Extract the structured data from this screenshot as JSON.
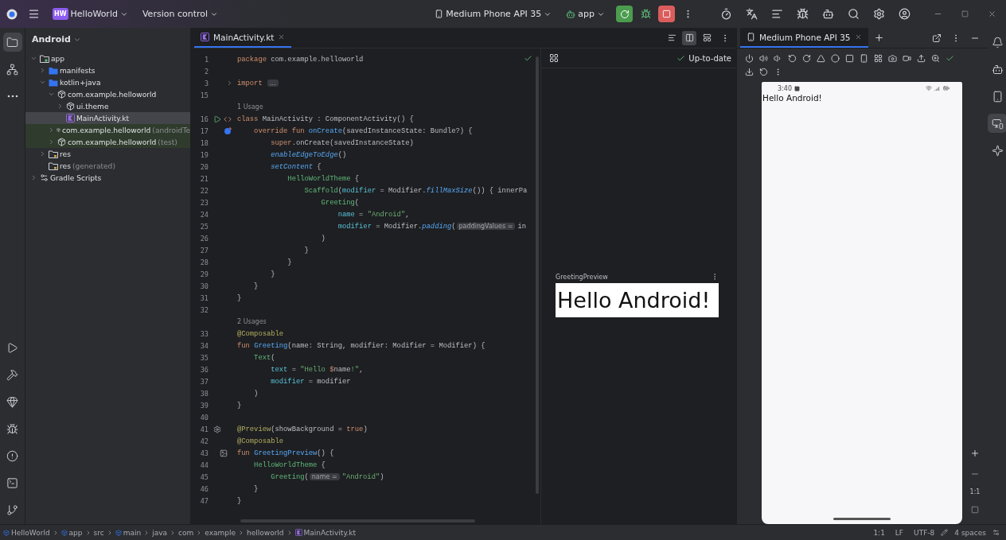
{
  "title_bar": {
    "project_badge": "HW",
    "project": "HelloWorld",
    "vcs": "Version control",
    "device": "Medium Phone API 35",
    "run_config": "app"
  },
  "left_tools": {
    "top": [
      {
        "kind": "project",
        "selected": true
      },
      {
        "kind": "structure",
        "selected": false
      },
      {
        "kind": "more",
        "selected": false
      }
    ],
    "bottom": [
      {
        "kind": "run",
        "selected": false
      },
      {
        "kind": "build",
        "selected": false
      },
      {
        "kind": "gem",
        "selected": false
      },
      {
        "kind": "logcat",
        "selected": false
      },
      {
        "kind": "problems",
        "selected": false
      },
      {
        "kind": "terminal",
        "selected": false
      },
      {
        "kind": "git",
        "selected": false
      }
    ]
  },
  "project_panel": {
    "title": "Android",
    "tree": [
      {
        "label": "app",
        "kind": "module",
        "expanded": true,
        "selected": false,
        "children": [
          {
            "label": "manifests",
            "kind": "source",
            "expanded": false,
            "selected": false
          },
          {
            "label": "kotlin+java",
            "kind": "source",
            "expanded": true,
            "selected": false,
            "children": [
              {
                "label": "com.example.helloworld",
                "kind": "package",
                "expanded": true,
                "selected": false,
                "children": [
                  {
                    "label": "ui.theme",
                    "kind": "package",
                    "expanded": false,
                    "selected": false
                  },
                  {
                    "label": "MainActivity.kt",
                    "kind": "kotlin",
                    "selected": true
                  }
                ]
              },
              {
                "label": "com.example.helloworld",
                "suffix": "(androidTe",
                "kind": "test-package",
                "expanded": false,
                "selected": false
              },
              {
                "label": "com.example.helloworld",
                "suffix": "(test)",
                "kind": "test-package",
                "expanded": false,
                "selected": false
              }
            ]
          },
          {
            "label": "res",
            "kind": "resource",
            "expanded": false,
            "selected": false
          },
          {
            "label": "res",
            "suffix": "(generated)",
            "kind": "resource",
            "selected": false
          }
        ]
      },
      {
        "label": "Gradle Scripts",
        "kind": "scripts",
        "expanded": false,
        "selected": false
      }
    ]
  },
  "editor": {
    "tab": {
      "label": "MainActivity.kt",
      "selected": true
    },
    "view_modes": [
      {
        "kind": "code",
        "selected": false
      },
      {
        "kind": "split",
        "selected": true
      },
      {
        "kind": "design",
        "selected": false
      }
    ],
    "lines": [
      {
        "kind": "code",
        "number": "1",
        "tokens": [
          {
            "text": "package ",
            "kind": "kw"
          },
          {
            "text": "com.example.helloworld",
            "kind": "plain"
          }
        ]
      },
      {
        "kind": "code",
        "number": "2"
      },
      {
        "kind": "code",
        "number": "3",
        "markers": [
          {
            "kind": "fold"
          }
        ],
        "tokens": [
          {
            "text": "import ",
            "kind": "kw"
          },
          {
            "text": "...",
            "kind": "fold"
          }
        ]
      },
      {
        "kind": "code",
        "number": "15"
      },
      {
        "kind": "usage",
        "text": "1 Usage"
      },
      {
        "kind": "code",
        "number": "16",
        "markers": [
          {
            "kind": "run"
          },
          {
            "kind": "code"
          }
        ],
        "tokens": [
          {
            "text": "class ",
            "kind": "kw"
          },
          {
            "text": "MainActivity : ComponentActivity() {",
            "kind": "plain"
          }
        ]
      },
      {
        "kind": "code",
        "number": "17",
        "markers": [
          {
            "kind": "override"
          }
        ],
        "tokens": [
          {
            "text": "    override fun ",
            "kind": "kw"
          },
          {
            "text": "onCreate",
            "kind": "fn"
          },
          {
            "text": "(savedInstanceState: Bundle?) {",
            "kind": "plain"
          }
        ]
      },
      {
        "kind": "code",
        "number": "18",
        "tokens": [
          {
            "text": "        super",
            "kind": "kw"
          },
          {
            "text": ".onCreate(savedInstanceState)",
            "kind": "plain"
          }
        ]
      },
      {
        "kind": "code",
        "number": "19",
        "tokens": [
          {
            "text": "        enableEdgeToEdge",
            "kind": "call"
          },
          {
            "text": "()",
            "kind": "plain"
          }
        ]
      },
      {
        "kind": "code",
        "number": "20",
        "tokens": [
          {
            "text": "        setContent",
            "kind": "call"
          },
          {
            "text": " {",
            "kind": "plain"
          }
        ]
      },
      {
        "kind": "code",
        "number": "21",
        "tokens": [
          {
            "text": "            HelloWorldTheme",
            "kind": "composable"
          },
          {
            "text": " {",
            "kind": "plain"
          }
        ]
      },
      {
        "kind": "code",
        "number": "22",
        "tokens": [
          {
            "text": "                Scaffold",
            "kind": "composable"
          },
          {
            "text": "(",
            "kind": "plain"
          },
          {
            "text": "modifier",
            "kind": "param"
          },
          {
            "text": " = Modifier.",
            "kind": "plain"
          },
          {
            "text": "fillMaxSize",
            "kind": "call"
          },
          {
            "text": "()) { innerPa",
            "kind": "plain"
          }
        ]
      },
      {
        "kind": "code",
        "number": "23",
        "tokens": [
          {
            "text": "                    Greeting",
            "kind": "composable"
          },
          {
            "text": "(",
            "kind": "plain"
          }
        ]
      },
      {
        "kind": "code",
        "number": "24",
        "tokens": [
          {
            "text": "                        name",
            "kind": "param"
          },
          {
            "text": " = ",
            "kind": "plain"
          },
          {
            "text": "\"Android\"",
            "kind": "string"
          },
          {
            "text": ",",
            "kind": "plain"
          }
        ]
      },
      {
        "kind": "code",
        "number": "25",
        "tokens": [
          {
            "text": "                        modifier",
            "kind": "param"
          },
          {
            "text": " = Modifier.",
            "kind": "plain"
          },
          {
            "text": "padding",
            "kind": "call"
          },
          {
            "text": "(",
            "kind": "plain"
          },
          {
            "text": "paddingValues =",
            "kind": "hint"
          },
          {
            "text": "in",
            "kind": "plain"
          }
        ]
      },
      {
        "kind": "code",
        "number": "26",
        "tokens": [
          {
            "text": "                    )",
            "kind": "plain"
          }
        ]
      },
      {
        "kind": "code",
        "number": "27",
        "tokens": [
          {
            "text": "                }",
            "kind": "plain"
          }
        ]
      },
      {
        "kind": "code",
        "number": "28",
        "tokens": [
          {
            "text": "            }",
            "kind": "plain"
          }
        ]
      },
      {
        "kind": "code",
        "number": "29",
        "tokens": [
          {
            "text": "        }",
            "kind": "plain"
          }
        ]
      },
      {
        "kind": "code",
        "number": "30",
        "tokens": [
          {
            "text": "    }",
            "kind": "plain"
          }
        ]
      },
      {
        "kind": "code",
        "number": "31",
        "tokens": [
          {
            "text": "}",
            "kind": "plain"
          }
        ]
      },
      {
        "kind": "code",
        "number": "32"
      },
      {
        "kind": "usage",
        "text": "2 Usages"
      },
      {
        "kind": "code",
        "number": "33",
        "tokens": [
          {
            "text": "@Composable",
            "kind": "annotation"
          }
        ]
      },
      {
        "kind": "code",
        "number": "34",
        "tokens": [
          {
            "text": "fun ",
            "kind": "kw"
          },
          {
            "text": "Greeting",
            "kind": "fn"
          },
          {
            "text": "(name: String, modifier: Modifier = Modifier) {",
            "kind": "plain"
          }
        ]
      },
      {
        "kind": "code",
        "number": "35",
        "tokens": [
          {
            "text": "    Text",
            "kind": "composable"
          },
          {
            "text": "(",
            "kind": "plain"
          }
        ]
      },
      {
        "kind": "code",
        "number": "36",
        "tokens": [
          {
            "text": "        text",
            "kind": "param"
          },
          {
            "text": " = ",
            "kind": "plain"
          },
          {
            "text": "\"Hello ",
            "kind": "string"
          },
          {
            "text": "$",
            "kind": "kw"
          },
          {
            "text": "name",
            "kind": "plain"
          },
          {
            "text": "!\"",
            "kind": "string"
          },
          {
            "text": ",",
            "kind": "plain"
          }
        ]
      },
      {
        "kind": "code",
        "number": "37",
        "tokens": [
          {
            "text": "        modifier",
            "kind": "param"
          },
          {
            "text": " = modifier",
            "kind": "plain"
          }
        ]
      },
      {
        "kind": "code",
        "number": "38",
        "tokens": [
          {
            "text": "    )",
            "kind": "plain"
          }
        ]
      },
      {
        "kind": "code",
        "number": "39",
        "tokens": [
          {
            "text": "}",
            "kind": "plain"
          }
        ]
      },
      {
        "kind": "code",
        "number": "40"
      },
      {
        "kind": "code",
        "number": "41",
        "markers": [
          {
            "kind": "settings"
          }
        ],
        "tokens": [
          {
            "text": "@Preview",
            "kind": "annotation"
          },
          {
            "text": "(showBackground = ",
            "kind": "plain"
          },
          {
            "text": "true",
            "kind": "kw"
          },
          {
            "text": ")",
            "kind": "plain"
          }
        ]
      },
      {
        "kind": "code",
        "number": "42",
        "tokens": [
          {
            "text": "@Composable",
            "kind": "annotation"
          }
        ]
      },
      {
        "kind": "code",
        "number": "43",
        "markers": [
          {
            "kind": "preview"
          }
        ],
        "tokens": [
          {
            "text": "fun ",
            "kind": "kw"
          },
          {
            "text": "GreetingPreview",
            "kind": "fn"
          },
          {
            "text": "() {",
            "kind": "plain"
          }
        ]
      },
      {
        "kind": "code",
        "number": "44",
        "tokens": [
          {
            "text": "    HelloWorldTheme",
            "kind": "composable"
          },
          {
            "text": " {",
            "kind": "plain"
          }
        ]
      },
      {
        "kind": "code",
        "number": "45",
        "tokens": [
          {
            "text": "        Greeting",
            "kind": "composable"
          },
          {
            "text": "(",
            "kind": "plain"
          },
          {
            "text": "name =",
            "kind": "hint"
          },
          {
            "text": "\"Android\"",
            "kind": "string"
          },
          {
            "text": ")",
            "kind": "plain"
          }
        ]
      },
      {
        "kind": "code",
        "number": "46",
        "tokens": [
          {
            "text": "    }",
            "kind": "plain"
          }
        ]
      },
      {
        "kind": "code",
        "number": "47",
        "tokens": [
          {
            "text": "}",
            "kind": "plain"
          }
        ]
      }
    ]
  },
  "preview": {
    "status": "Up-to-date",
    "card_title": "GreetingPreview",
    "rendered_text": "Hello Android!"
  },
  "running_devices": {
    "tab": {
      "label": "Medium Phone API 35",
      "selected": true
    },
    "phone": {
      "time": "3:40",
      "text": "Hello Android!"
    },
    "zoom_label": "1:1"
  },
  "right_tools": [
    {
      "kind": "notifications",
      "selected": false
    },
    {
      "kind": "assistant",
      "selected": false
    },
    {
      "kind": "device-manager",
      "selected": false
    },
    {
      "kind": "running-devices",
      "selected": true
    },
    {
      "kind": "sparkle",
      "selected": false
    }
  ],
  "status_bar": {
    "breadcrumbs": [
      {
        "label": "HelloWorld",
        "kind": "module"
      },
      {
        "label": "app",
        "kind": "module"
      },
      {
        "label": "src",
        "kind": "plain"
      },
      {
        "label": "main",
        "kind": "module"
      },
      {
        "label": "java",
        "kind": "plain"
      },
      {
        "label": "com",
        "kind": "plain"
      },
      {
        "label": "example",
        "kind": "plain"
      },
      {
        "label": "helloworld",
        "kind": "plain"
      },
      {
        "label": "MainActivity.kt",
        "kind": "kotlin"
      }
    ],
    "position": "1:1",
    "line_ending": "LF",
    "encoding": "UTF-8",
    "indent": "4 spaces"
  }
}
